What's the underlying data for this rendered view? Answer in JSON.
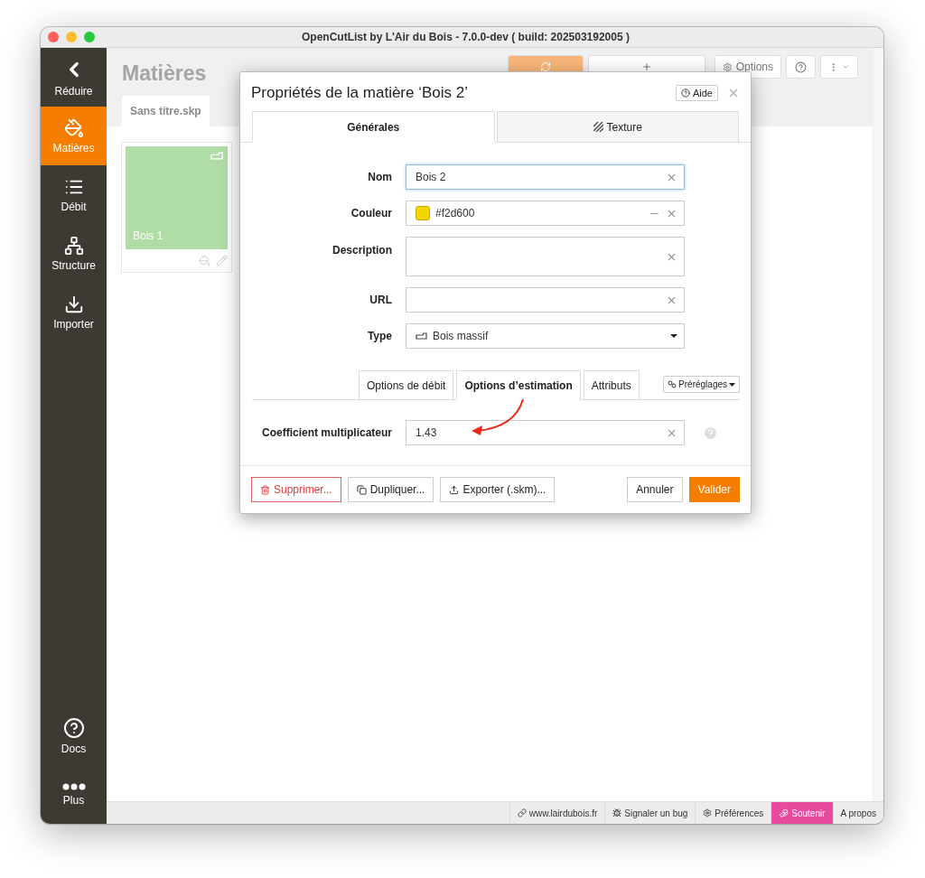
{
  "window": {
    "title": "OpenCutList by L'Air du Bois - 7.0.0-dev ( build: 202503192005 )"
  },
  "sidebar": {
    "items": [
      {
        "kind": "collapse",
        "label": "Réduire",
        "selected": false
      },
      {
        "kind": "materials",
        "label": "Matières",
        "selected": true
      },
      {
        "kind": "cutlist",
        "label": "Débit",
        "selected": false
      },
      {
        "kind": "structure",
        "label": "Structure",
        "selected": false
      },
      {
        "kind": "import",
        "label": "Importer",
        "selected": false
      }
    ],
    "bottom_items": [
      {
        "kind": "docs",
        "label": "Docs",
        "selected": false
      },
      {
        "kind": "more",
        "label": "Plus",
        "selected": false
      }
    ]
  },
  "page": {
    "title": "Matières",
    "toolbar": [
      {
        "kind": "refresh"
      },
      {
        "kind": "add"
      },
      {
        "kind": "options",
        "label": "Options"
      },
      {
        "kind": "help"
      },
      {
        "kind": "menu"
      }
    ],
    "file_tab": "Sans titre.skp",
    "materials": [
      {
        "name": "Bois 1",
        "color": "#b0dca6"
      }
    ]
  },
  "dialog": {
    "title": "Propriétés de la matière ‘Bois 2’",
    "help_button": "Aide",
    "tabs": [
      {
        "label": "Générales",
        "selected": true,
        "kind": "general"
      },
      {
        "label": "Texture",
        "selected": false,
        "kind": "texture"
      }
    ],
    "fields": [
      {
        "kind": "text",
        "label": "Nom",
        "value": "Bois 2",
        "focused": true
      },
      {
        "kind": "color",
        "label": "Couleur",
        "value": "#f2d600",
        "color": "#f2d600"
      },
      {
        "kind": "textarea",
        "label": "Description",
        "focused": false
      },
      {
        "kind": "text",
        "label": "URL",
        "focused": false
      },
      {
        "kind": "select",
        "label": "Type",
        "value": "Bois massif"
      }
    ],
    "subtabs": [
      {
        "label": "Options de débit",
        "selected": false
      },
      {
        "label": "Options d’estimation",
        "selected": true
      },
      {
        "label": "Attributs",
        "selected": false
      }
    ],
    "presets_button": "Préréglages",
    "coefficient": {
      "label": "Coefficient multiplicateur",
      "value": "1.43"
    },
    "footer_left": [
      {
        "kind": "delete",
        "label": "Supprimer..."
      },
      {
        "kind": "duplicate",
        "label": "Dupliquer..."
      },
      {
        "kind": "export",
        "label": "Exporter (.skm)..."
      }
    ],
    "footer_right": [
      {
        "kind": "cancel",
        "label": "Annuler"
      },
      {
        "kind": "primary",
        "label": "Valider"
      }
    ]
  },
  "status_bar": [
    {
      "kind": "link",
      "label": "www.lairdubois.fr"
    },
    {
      "kind": "bug",
      "label": "Signaler un bug"
    },
    {
      "kind": "settings",
      "label": "Préférences"
    },
    {
      "kind": "support",
      "label": "Soutenir"
    },
    {
      "kind": "about",
      "label": "A propos"
    }
  ]
}
